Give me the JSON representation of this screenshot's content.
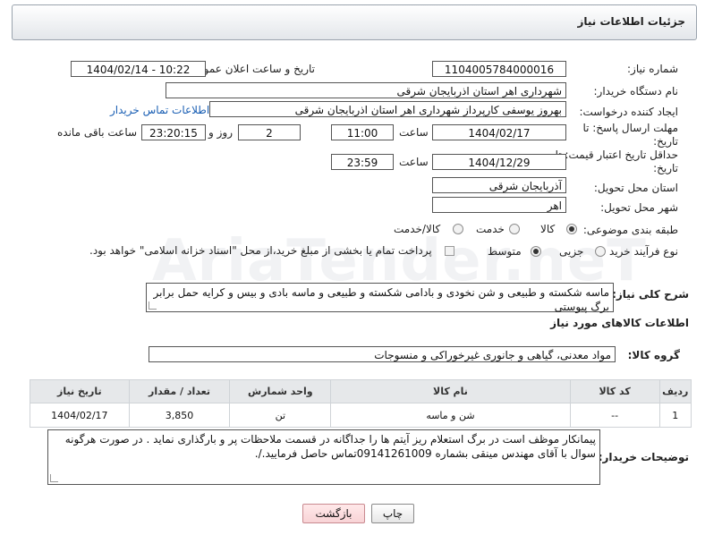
{
  "header": {
    "title": "جزئیات اطلاعات نیاز"
  },
  "fields": {
    "need_number_label": "شماره نیاز:",
    "need_number": "1104005784000016",
    "announce_label": "تاریخ و ساعت اعلان عمومی:",
    "announce_value": "1404/02/14 - 10:22",
    "buyer_org_label": "نام دستگاه خریدار:",
    "buyer_org": "شهرداری اهر استان اذربایجان شرقی",
    "creator_label": "ایجاد کننده درخواست:",
    "creator": "بهروز یوسفی کارپرداز شهرداری اهر استان اذربایجان شرقی",
    "contact_link": "اطلاعات تماس خریدار",
    "deadline_label": "مهلت ارسال پاسخ: تا تاریخ:",
    "deadline_date": "1404/02/17",
    "time_label": "ساعت",
    "deadline_time": "11:00",
    "days_value": "2",
    "days_label": "روز و",
    "remaining_time": "23:20:15",
    "remaining_label": "ساعت باقی مانده",
    "validity_label": "حداقل تاریخ اعتبار قیمت: تا تاریخ:",
    "validity_date": "1404/12/29",
    "validity_time_label": "ساعت",
    "validity_time": "23:59",
    "province_label": "استان محل تحویل:",
    "province": "آذربایجان شرقی",
    "city_label": "شهر محل تحویل:",
    "city": "اهر",
    "category_label": "طبقه بندی موضوعی:",
    "category_options": [
      "کالا",
      "خدمت",
      "کالا/خدمت"
    ],
    "process_label": "نوع فرآیند خرید :",
    "process_options": [
      "جزیی",
      "متوسط"
    ],
    "payment_note": "پرداخت تمام یا بخشی از مبلغ خرید،از محل \"اسناد خزانه اسلامی\" خواهد بود."
  },
  "description": {
    "label": "شرح کلی نیاز:",
    "text": "ماسه شکسته و طبیعی و شن نخودی و بادامی شکسته و طبیعی و ماسه بادی و بیس و کرایه حمل برابر برگ پیوستی"
  },
  "goods": {
    "section_title": "اطلاعات کالاهای مورد نیاز",
    "group_label": "گروه کالا:",
    "group_value": "مواد معدنی، گیاهی و جانوری غیرخوراکی و منسوجات",
    "columns": [
      "ردیف",
      "کد کالا",
      "نام کالا",
      "واحد شمارش",
      "تعداد / مقدار",
      "تاریخ نیاز"
    ],
    "rows": [
      {
        "row": "1",
        "code": "--",
        "name": "شن و ماسه",
        "unit": "تن",
        "qty": "3,850",
        "date": "1404/02/17"
      }
    ]
  },
  "buyer_notes": {
    "label": "توضیحات خریدار:",
    "text": "پیمانکار موظف است در برگ استعلام ریز آیتم ها را جداگانه در قسمت ملاحظات پر و بارگذاری نماید . در صورت هرگونه سوال با آقای مهندس مینقی بشماره 09141261009تماس حاصل فرمایید./."
  },
  "buttons": {
    "print": "چاپ",
    "back": "بازگشت"
  },
  "watermark": "AriaTender.neT"
}
